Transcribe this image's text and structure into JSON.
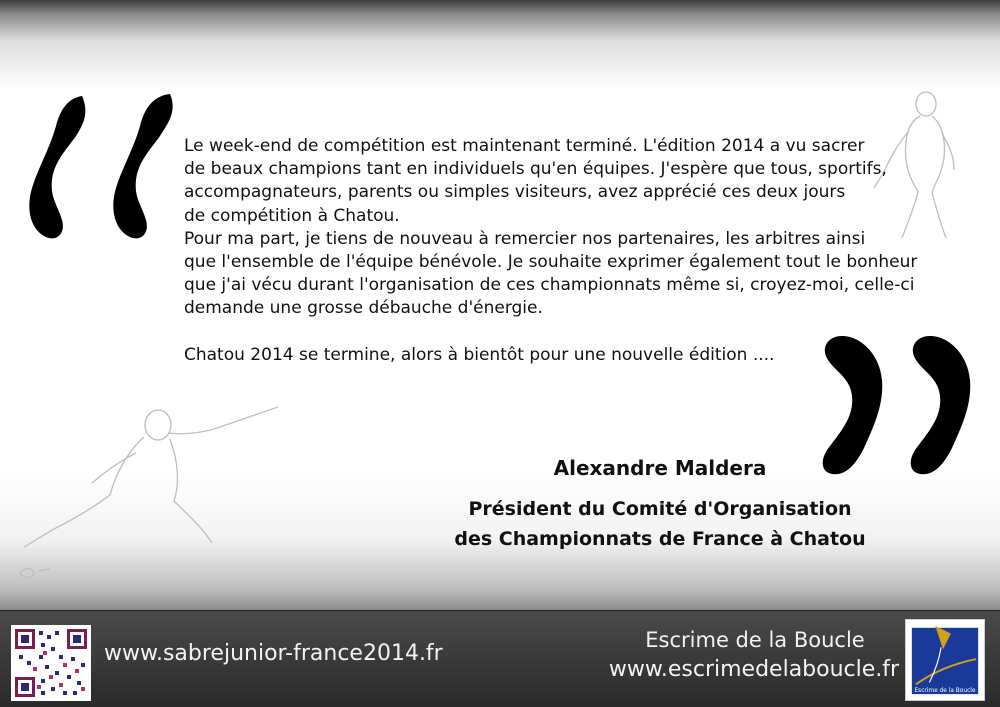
{
  "message": {
    "lines": [
      "Le week-end de compétition est maintenant terminé. L'édition 2014 a vu sacrer",
      "de beaux champions tant en individuels qu'en équipes. J'espère que tous, sportifs,",
      "accompagnateurs, parents ou simples visiteurs, avez apprécié ces deux jours",
      "de compétition à Chatou.",
      "Pour ma part, je tiens de nouveau à remercier nos partenaires, les arbitres ainsi",
      "que l'ensemble de l'équipe bénévole. Je souhaite exprimer également tout le bonheur",
      "que j'ai vécu durant l'organisation de ces championnats même si, croyez-moi, celle-ci",
      "demande une grosse débauche d'énergie."
    ],
    "signoff": "Chatou 2014 se termine, alors à bientôt pour une nouvelle édition ...."
  },
  "signature": {
    "name": "Alexandre Maldera",
    "title_line1": "Président du Comité d'Organisation",
    "title_line2": "des Championnats de France à Chatou"
  },
  "footer": {
    "website": "www.sabrejunior-france2014.fr",
    "club_name": "Escrime de la Boucle",
    "club_website": "www.escrimedelaboucle.fr",
    "logo_text": "Escrime de la Boucle"
  },
  "colors": {
    "footer_bg": "#3a3a3a",
    "logo_blue": "#1a3a9a",
    "logo_gold": "#d4a017"
  },
  "icons": {
    "open_quote": "open-quote-icon",
    "close_quote": "close-quote-icon",
    "fencer_left": "fencer-lunge-icon",
    "fencer_right": "fencer-standing-icon",
    "qr": "qr-code-icon",
    "club_logo": "club-logo-icon"
  }
}
